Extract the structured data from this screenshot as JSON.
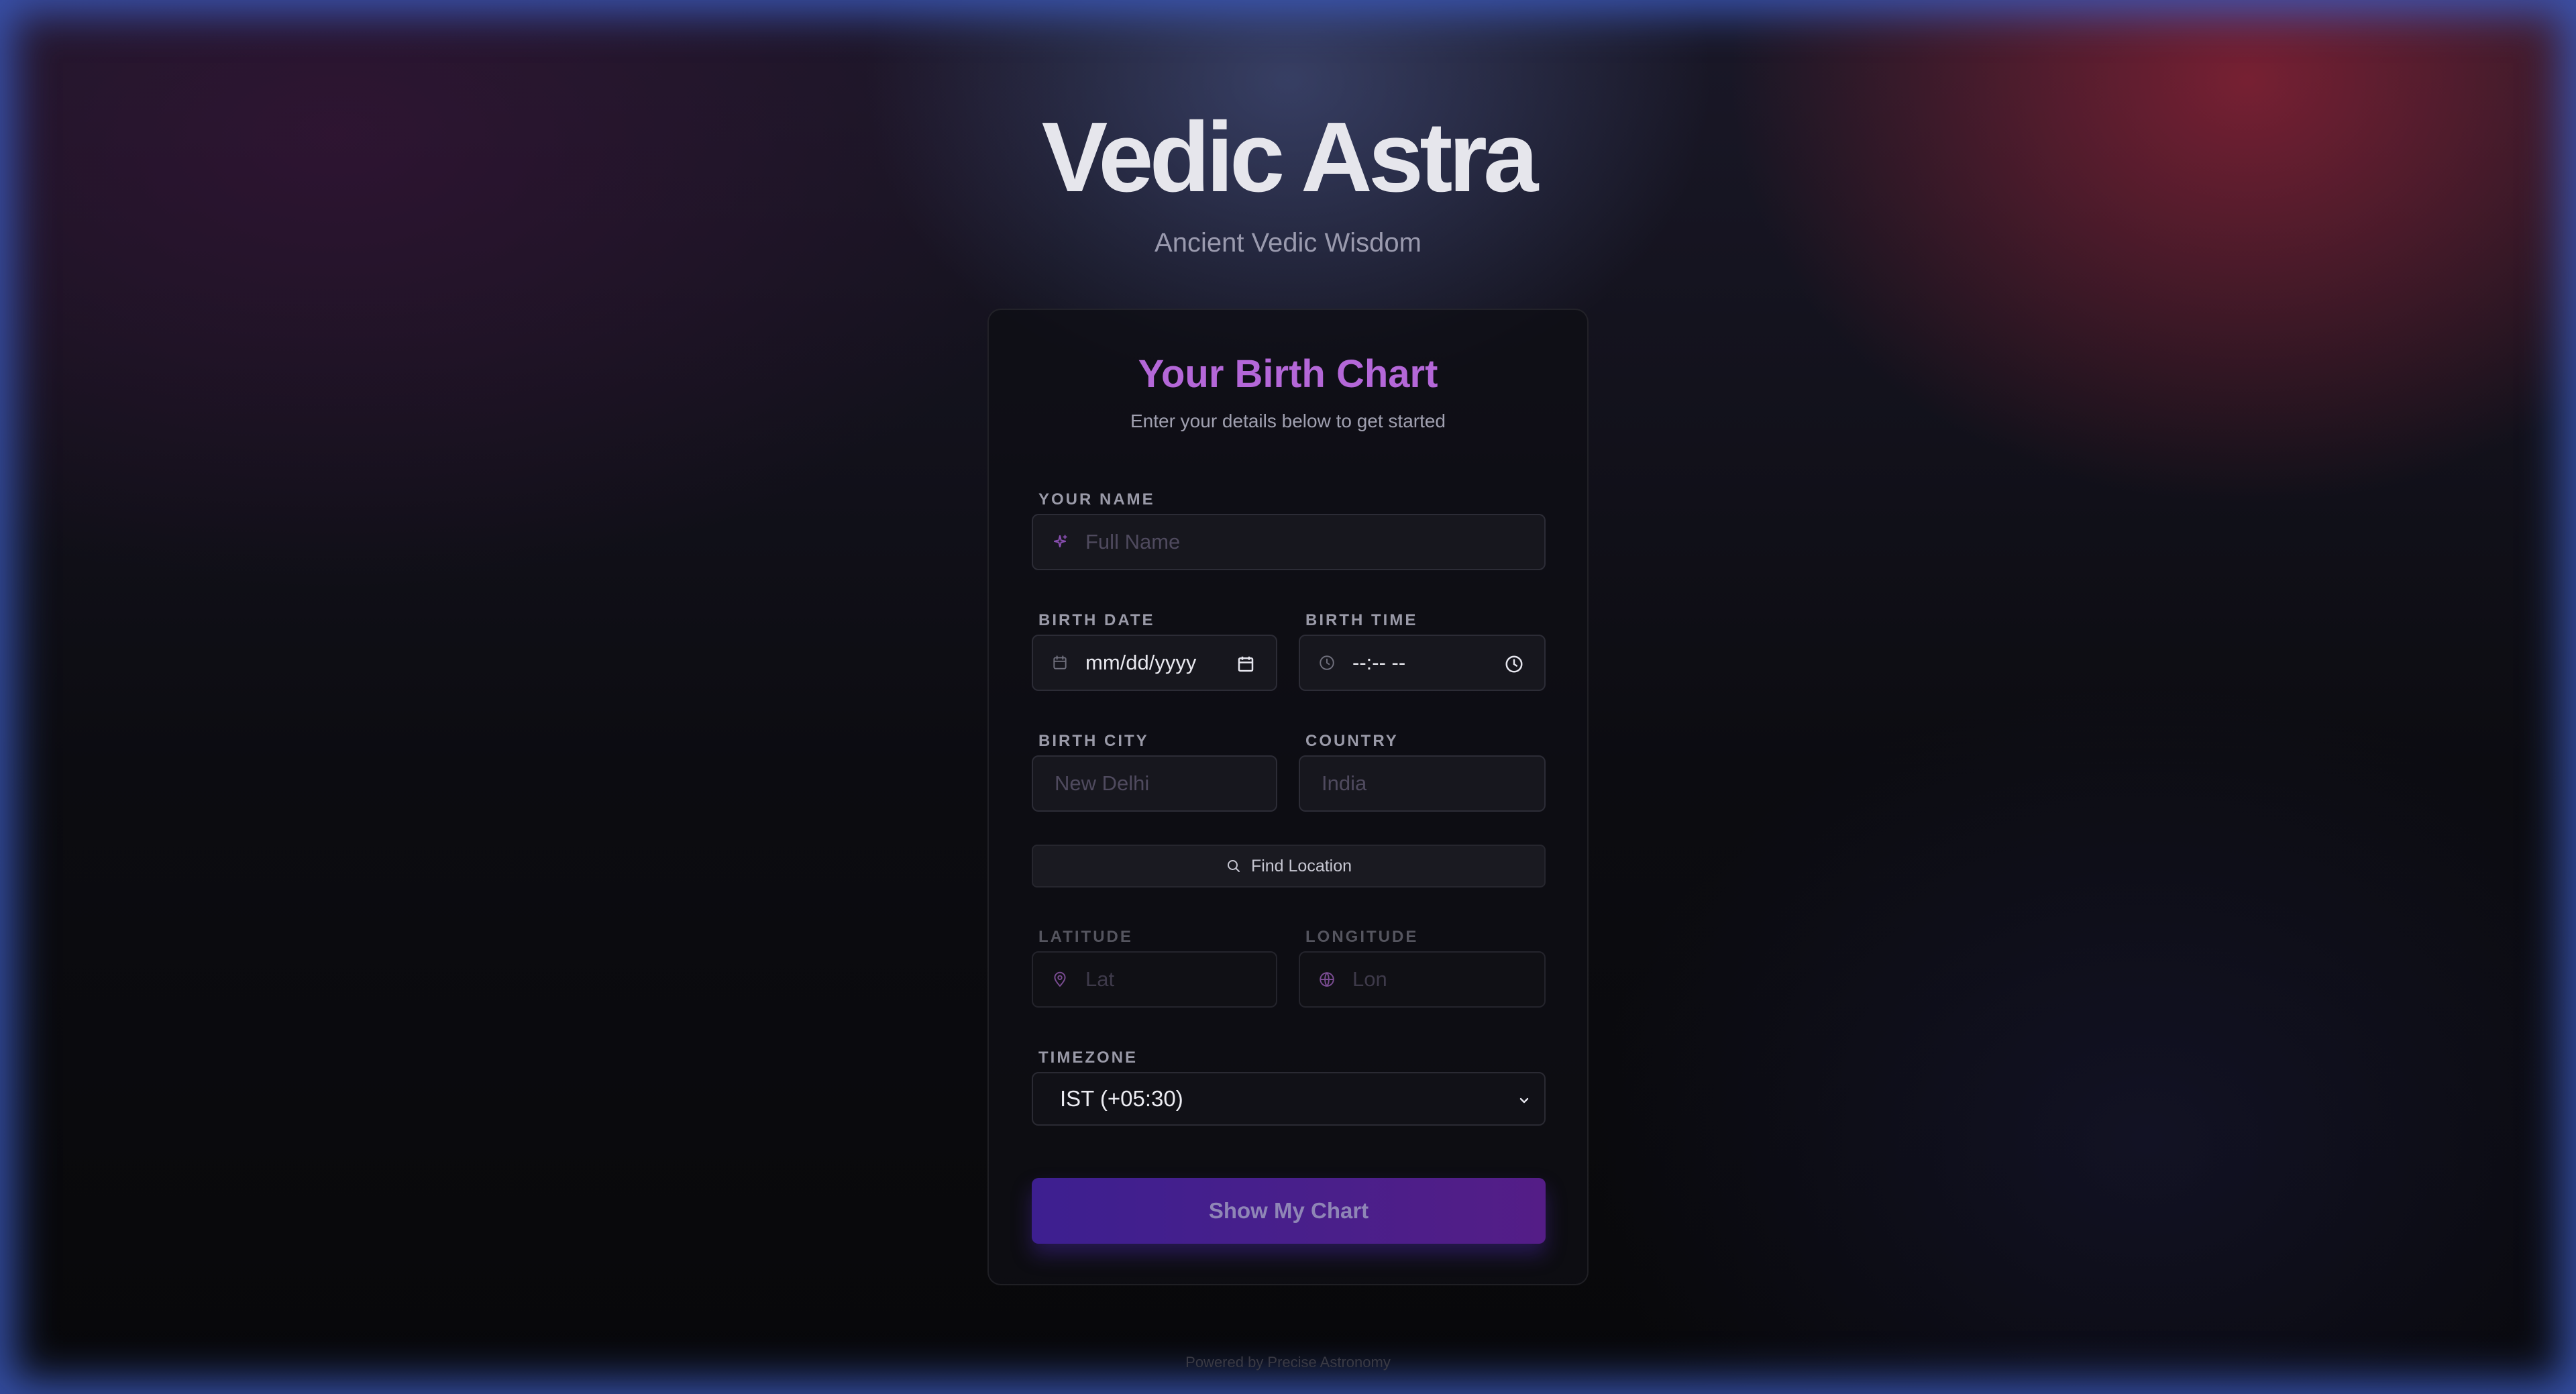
{
  "app": {
    "title": "Vedic Astra",
    "subtitle": "Ancient Vedic Wisdom"
  },
  "form": {
    "title": "Your Birth Chart",
    "subtitle": "Enter your details below to get started",
    "name": {
      "label": "YOUR NAME",
      "placeholder": "Full Name",
      "icon": "sparkles-icon"
    },
    "birth_date": {
      "label": "BIRTH DATE",
      "value": "mm/dd/yyyy",
      "icon": "calendar-icon"
    },
    "birth_time": {
      "label": "BIRTH TIME",
      "value": "--:-- --",
      "icon": "clock-icon"
    },
    "birth_city": {
      "label": "BIRTH CITY",
      "placeholder": "New Delhi"
    },
    "country": {
      "label": "COUNTRY",
      "placeholder": "India"
    },
    "find_location_label": "Find Location",
    "latitude": {
      "label": "LATITUDE",
      "placeholder": "Lat",
      "icon": "map-pin-icon"
    },
    "longitude": {
      "label": "LONGITUDE",
      "placeholder": "Lon",
      "icon": "globe-icon"
    },
    "timezone": {
      "label": "TIMEZONE",
      "selected": "IST (+05:30)"
    },
    "submit_label": "Show My Chart"
  },
  "footer": {
    "text": "Powered by Precise Astronomy"
  },
  "colors": {
    "accent_title": "#b467d8",
    "button_gradient_start": "#3d1f90",
    "button_gradient_end": "#541d87",
    "frame_glow": "#3c5abe"
  }
}
